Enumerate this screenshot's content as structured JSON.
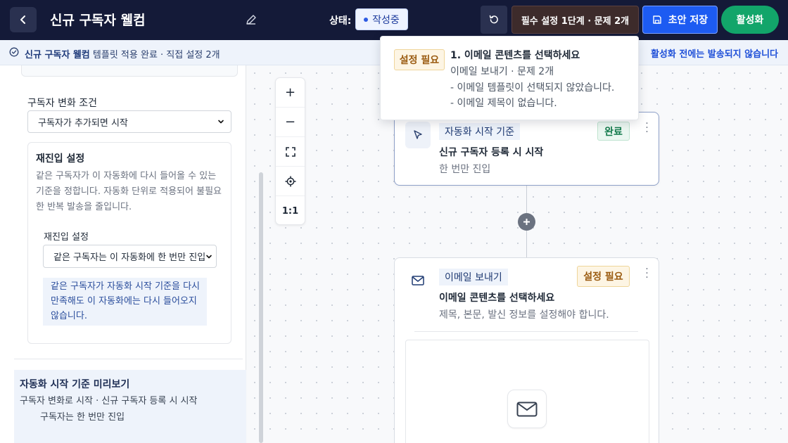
{
  "header": {
    "title": "신규 구독자 웰컴",
    "status_label": "상태:",
    "status_value": "작성중",
    "required_button": "필수 설정 1단계 · 문제 2개",
    "save_button": "초안 저장",
    "activate_button": "활성화"
  },
  "infobar": {
    "bold": "신규 구독자 웰컴",
    "text": " 템플릿 적용 완료 · 직접 설정 2개",
    "right": "활성화 전에는 발송되지 않습니다"
  },
  "left_panel": {
    "condition_title": "구독자 변화 조건",
    "condition_value": "구독자가 추가되면 시작",
    "reentry_title": "재진입 설정",
    "reentry_desc": "같은 구독자가 이 자동화에 다시 들어올 수 있는 기준을 정합니다. 자동화 단위로 적용되어 불필요한 반복 발송을 줄입니다.",
    "reentry_sub_title": "재진입 설정",
    "reentry_sub_value": "같은 구독자는 이 자동화에 한 번만 진입",
    "reentry_note": "같은 구독자가 자동화 시작 기준을 다시 만족해도 이 자동화에는 다시 들어오지 않습니다.",
    "preview_title": "자동화 시작 기준 미리보기",
    "preview_text": "구독자 변화로 시작 · 신규 구독자 등록 시 시작",
    "preview_sub": "구독자는 한 번만 진입"
  },
  "zoom": {
    "zoom_in": "+",
    "zoom_out": "−",
    "reset": "1:1"
  },
  "trigger_node": {
    "chip": "자동화 시작 기준",
    "badge": "완료",
    "title": "신규 구독자 등록 시 시작",
    "desc": "한 번만 진입"
  },
  "email_node": {
    "chip": "이메일 보내기",
    "badge": "설정 필요",
    "title": "이메일 콘텐츠를 선택하세요",
    "desc": "제목, 본문, 발신 정보를 설정해야 합니다."
  },
  "popover": {
    "badge": "설정 필요",
    "title": "1. 이메일 콘텐츠를 선택하세요",
    "sub": "이메일 보내기 · 문제 2개",
    "issues": [
      "- 이메일 템플릿이 선택되지 않았습니다.",
      "- 이메일 제목이 없습니다."
    ]
  },
  "colors": {
    "topbar": "#141a38",
    "save": "#1d5bf2",
    "activate": "#12a56a",
    "warn": "#9a5b10",
    "done": "#137a4c"
  },
  "icons": [
    "back-icon",
    "edit-icon",
    "undo-icon",
    "save-icon",
    "check-circle-icon",
    "chevron-down-icon",
    "zoom-in-icon",
    "zoom-out-icon",
    "fit-screen-icon",
    "center-icon",
    "cursor-icon",
    "mail-icon",
    "kebab-icon",
    "plus-icon"
  ]
}
